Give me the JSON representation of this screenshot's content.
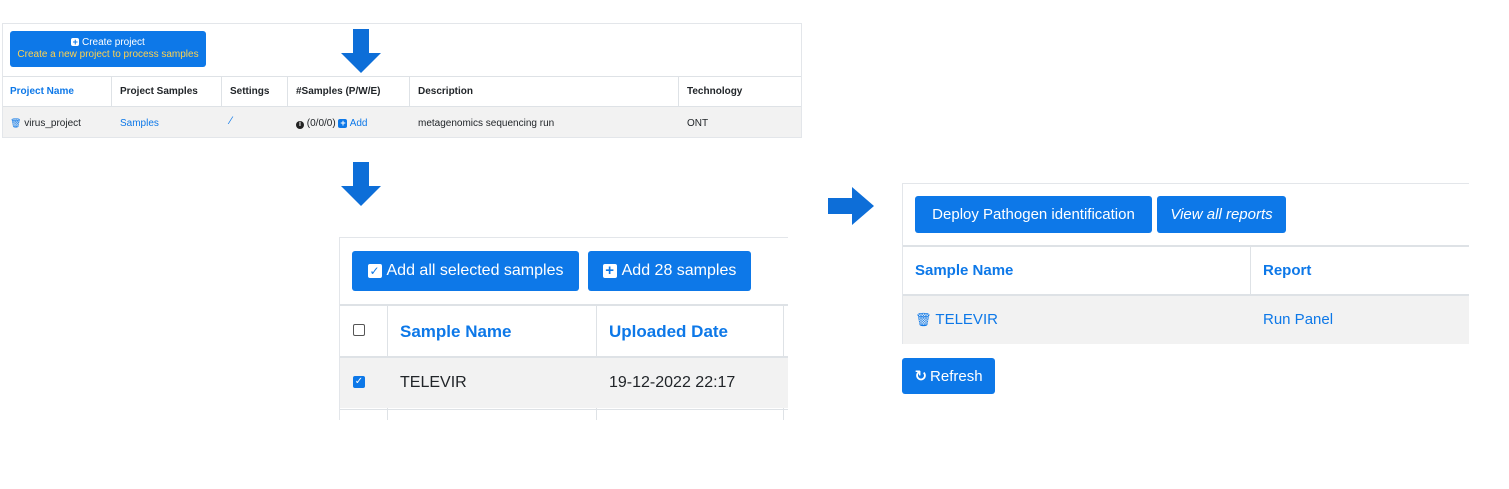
{
  "panel1": {
    "create_button": {
      "title": "Create project",
      "subtitle": "Create a new project to process samples"
    },
    "columns": [
      "Project Name",
      "Project Samples",
      "Settings",
      "#Samples (P/W/E)",
      "Description",
      "Technology"
    ],
    "row": {
      "project_name": "virus_project",
      "samples_link": "Samples",
      "samples_count": "(0/0/0)",
      "add_link": "Add",
      "description": "metagenomics sequencing run",
      "technology": "ONT"
    }
  },
  "panel2": {
    "add_selected_label": "Add all selected samples",
    "add_count_label": "Add 28 samples",
    "columns": [
      "Sample Name",
      "Uploaded Date"
    ],
    "rows": [
      {
        "checked": true,
        "sample_name": "TELEVIR",
        "uploaded_date": "19-12-2022 22:17"
      }
    ]
  },
  "panel3": {
    "deploy_label": "Deploy Pathogen identification",
    "view_reports_label": "View all reports",
    "columns": [
      "Sample Name",
      "Report"
    ],
    "rows": [
      {
        "sample_name": "TELEVIR",
        "report": "Run Panel"
      }
    ],
    "refresh_label": "Refresh"
  },
  "colors": {
    "accent": "#0d78e8",
    "row_stripe": "#f2f2f2",
    "subtitle_yellow": "#ffd24d"
  },
  "icons": [
    "trash-icon",
    "wand-icon",
    "info-icon",
    "plus-square-icon",
    "check-square-icon",
    "refresh-icon",
    "arrow-down-icon",
    "arrow-right-icon"
  ]
}
